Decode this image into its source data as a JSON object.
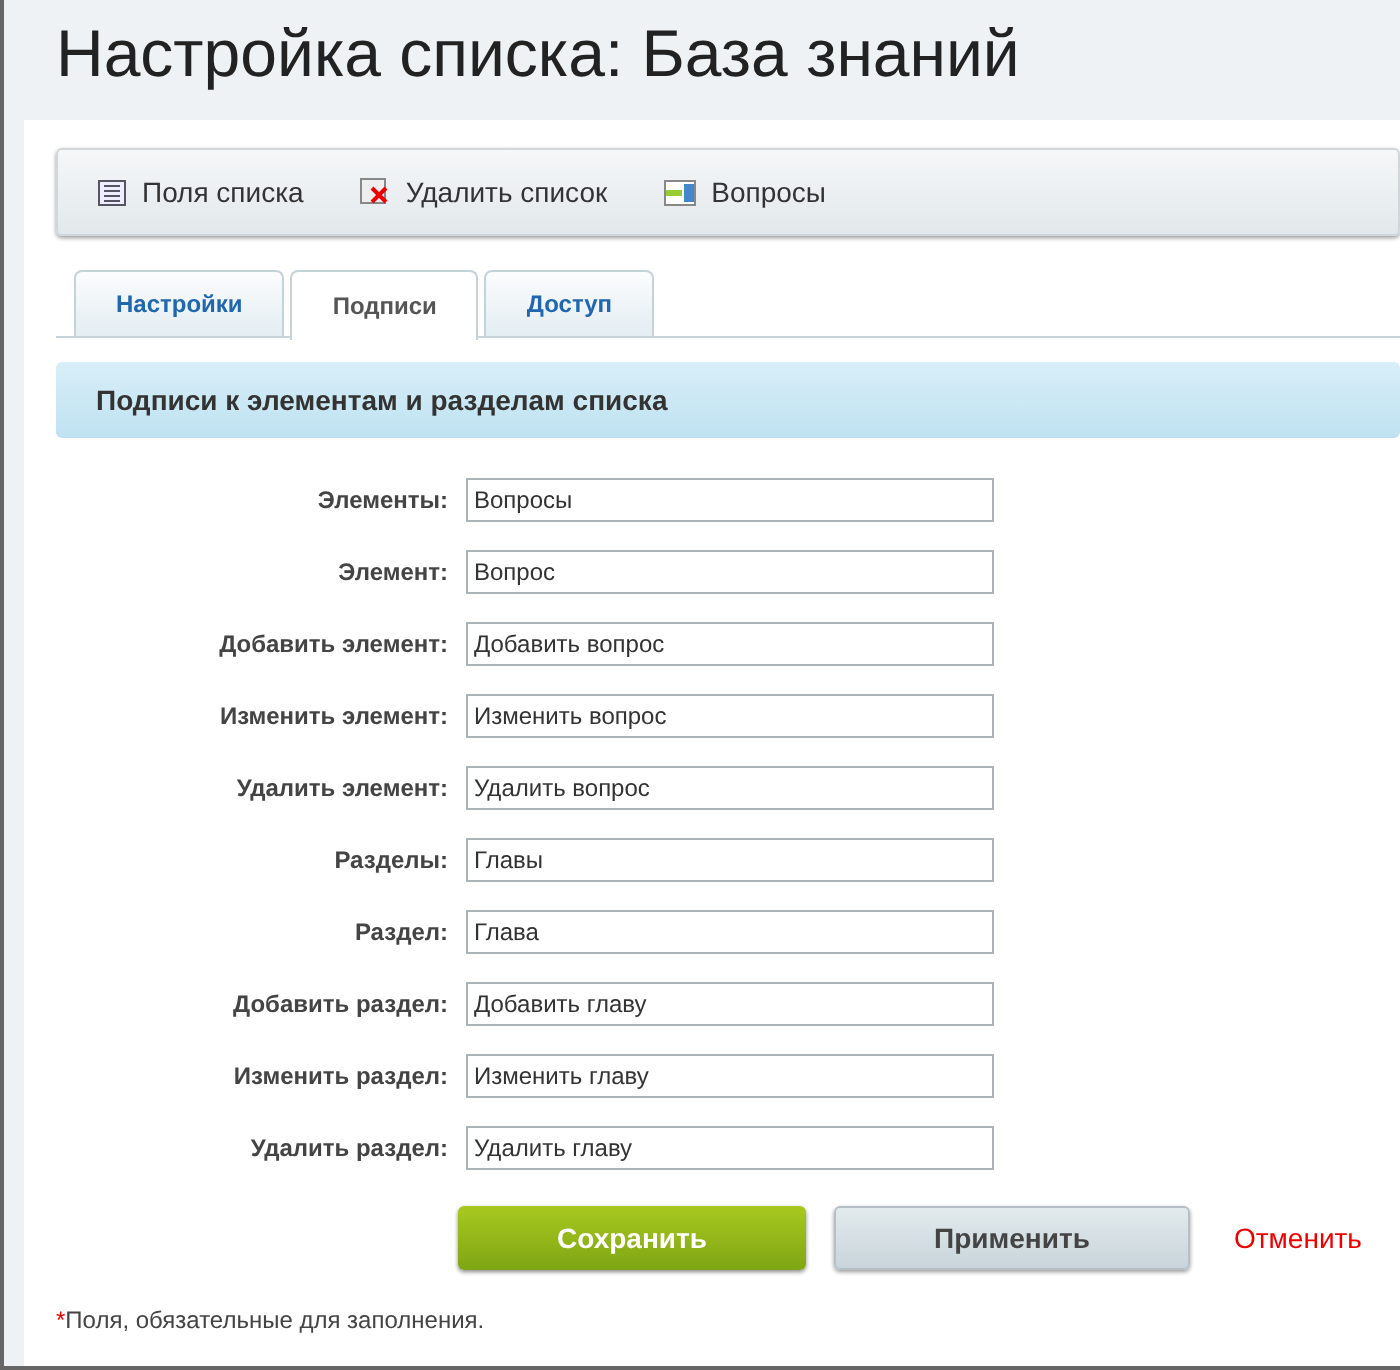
{
  "title": "Настройка списка: База знаний",
  "toolbar": [
    {
      "kind": "fields",
      "label": "Поля списка"
    },
    {
      "kind": "delete",
      "label": "Удалить список"
    },
    {
      "kind": "questions",
      "label": "Вопросы"
    }
  ],
  "tabs": [
    {
      "label": "Настройки",
      "selected": false
    },
    {
      "label": "Подписи",
      "selected": true
    },
    {
      "label": "Доступ",
      "selected": false
    }
  ],
  "section_title": "Подписи к элементам и разделам списка",
  "fields": [
    {
      "label": "Элементы:",
      "value": "Вопросы"
    },
    {
      "label": "Элемент:",
      "value": "Вопрос"
    },
    {
      "label": "Добавить элемент:",
      "value": "Добавить вопрос"
    },
    {
      "label": "Изменить элемент:",
      "value": "Изменить вопрос"
    },
    {
      "label": "Удалить элемент:",
      "value": "Удалить вопрос"
    },
    {
      "label": "Разделы:",
      "value": "Главы"
    },
    {
      "label": "Раздел:",
      "value": "Глава"
    },
    {
      "label": "Добавить раздел:",
      "value": "Добавить главу"
    },
    {
      "label": "Изменить раздел:",
      "value": "Изменить главу"
    },
    {
      "label": "Удалить раздел:",
      "value": "Удалить главу"
    }
  ],
  "buttons": {
    "save": "Сохранить",
    "apply": "Применить",
    "cancel": "Отменить"
  },
  "footnote": {
    "mark": "*",
    "text": "Поля, обязательные для заполнения."
  }
}
